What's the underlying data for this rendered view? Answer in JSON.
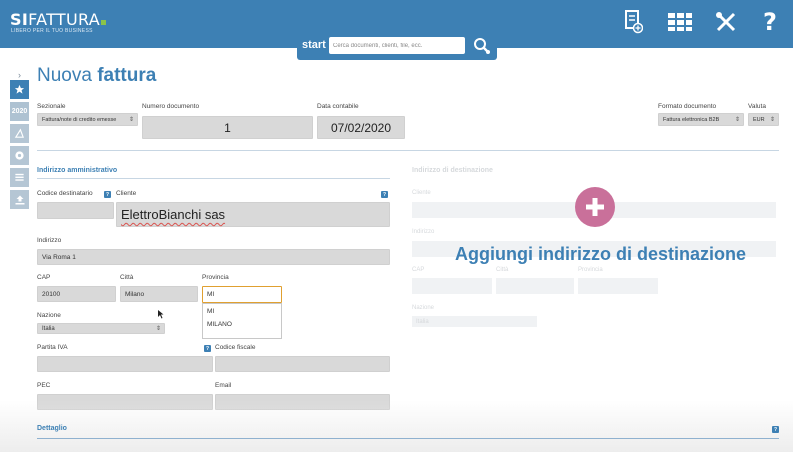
{
  "brand": {
    "name_bold": "SI",
    "name_thin": "FATTURA",
    "tagline": "LIBERO PER IL TUO BUSINESS",
    "accent": "#3d80b4",
    "dot_color": "#8bc34a"
  },
  "topbar": {
    "icons": [
      "document-add-icon",
      "grid-icon",
      "tools-icon",
      "help-icon"
    ]
  },
  "search": {
    "label": "start",
    "placeholder": "Cerca documenti, clienti, file, ecc."
  },
  "sidebar": {
    "items": [
      {
        "icon": "star-icon",
        "label": ""
      },
      {
        "icon": "year-badge",
        "label": "2020"
      },
      {
        "icon": "triangle-icon",
        "label": ""
      },
      {
        "icon": "gear-circle-icon",
        "label": ""
      },
      {
        "icon": "list-icon",
        "label": ""
      },
      {
        "icon": "upload-icon",
        "label": ""
      }
    ]
  },
  "page": {
    "title_light": "Nuova",
    "title_bold": "fattura"
  },
  "header_fields": {
    "sezionale_label": "Sezionale",
    "sezionale_value": "Fattura/note di credito emesse",
    "numero_label": "Numero documento",
    "numero_value": "1",
    "data_label": "Data contabile",
    "data_value": "07/02/2020",
    "formato_label": "Formato documento",
    "formato_value": "Fattura elettronica B2B",
    "valuta_label": "Valuta",
    "valuta_value": "EUR"
  },
  "admin_address": {
    "section_title": "Indirizzo amministrativo",
    "codice_label": "Codice destinatario",
    "codice_value": "",
    "cliente_label": "Cliente",
    "cliente_value": "ElettroBianchi sas",
    "indirizzo_label": "Indirizzo",
    "indirizzo_value": "Via Roma 1",
    "cap_label": "CAP",
    "cap_value": "20100",
    "citta_label": "Città",
    "citta_value": "Milano",
    "provincia_label": "Provincia",
    "provincia_value": "MI",
    "provincia_options": [
      "MI",
      "MILANO"
    ],
    "nazione_label": "Nazione",
    "nazione_value": "Italia",
    "piva_label": "Partita IVA",
    "cf_label": "Codice fiscale",
    "pec_label": "PEC",
    "email_label": "Email"
  },
  "destination": {
    "section_title": "Indirizzo di destinazione",
    "add_text": "Aggiungi indirizzo di destinazione",
    "cliente_label": "Cliente",
    "indirizzo_label": "Indirizzo",
    "cap_label": "CAP",
    "citta_label": "Città",
    "provincia_label": "Provincia",
    "nazione_label": "Nazione",
    "nazione_value": "Italia",
    "add_color": "#c9709a"
  },
  "detail": {
    "section_title": "Dettaglio"
  }
}
